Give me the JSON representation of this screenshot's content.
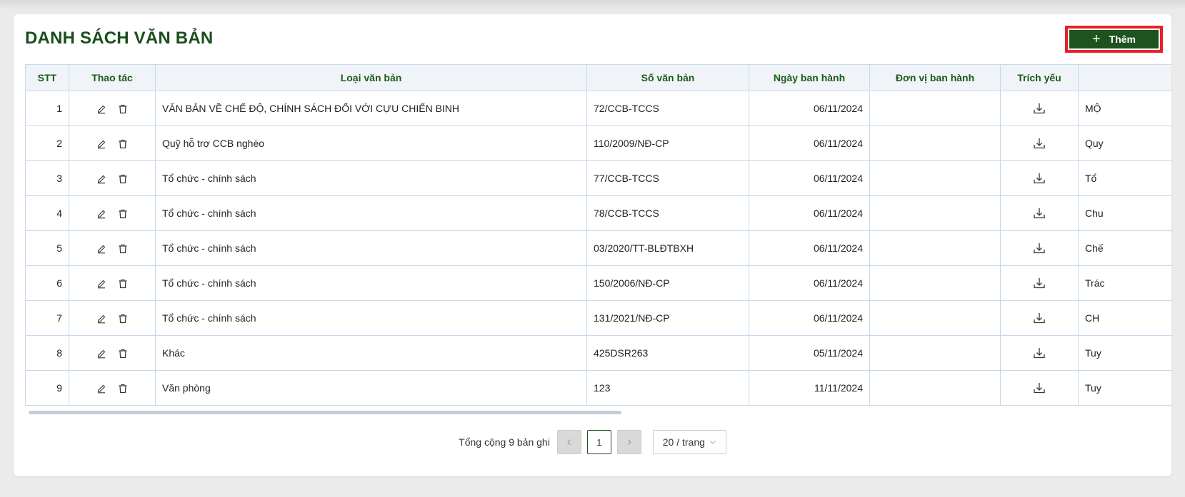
{
  "page": {
    "title": "DANH SÁCH VĂN BẢN",
    "add_label": "Thêm"
  },
  "table": {
    "headers": {
      "stt": "STT",
      "actions": "Thao tác",
      "type": "Loại văn bản",
      "number": "Số văn bản",
      "date": "Ngày ban hành",
      "unit": "Đơn vị ban hành",
      "abstract": "Trích yếu",
      "extra": ""
    },
    "rows": [
      {
        "stt": "1",
        "type": "VĂN BẢN VỀ CHẾ ĐỘ, CHÍNH SÁCH ĐỐI VỚI CỰU CHIẾN BINH",
        "number": "72/CCB-TCCS",
        "date": "06/11/2024",
        "unit": "",
        "extra": "MỘ"
      },
      {
        "stt": "2",
        "type": "Quỹ hỗ trợ CCB nghèo",
        "number": "110/2009/NĐ-CP",
        "date": "06/11/2024",
        "unit": "",
        "extra": "Quy"
      },
      {
        "stt": "3",
        "type": "Tổ chức - chính sách",
        "number": "77/CCB-TCCS",
        "date": "06/11/2024",
        "unit": "",
        "extra": "Tổ"
      },
      {
        "stt": "4",
        "type": "Tổ chức - chính sách",
        "number": "78/CCB-TCCS",
        "date": "06/11/2024",
        "unit": "",
        "extra": "Chu"
      },
      {
        "stt": "5",
        "type": "Tổ chức - chính sách",
        "number": "03/2020/TT-BLĐTBXH",
        "date": "06/11/2024",
        "unit": "",
        "extra": "Chế"
      },
      {
        "stt": "6",
        "type": "Tổ chức - chính sách",
        "number": "150/2006/NĐ-CP",
        "date": "06/11/2024",
        "unit": "",
        "extra": "Trác"
      },
      {
        "stt": "7",
        "type": "Tổ chức - chính sách",
        "number": "131/2021/NĐ-CP",
        "date": "06/11/2024",
        "unit": "",
        "extra": "CH"
      },
      {
        "stt": "8",
        "type": "Khác",
        "number": "425DSR263",
        "date": "05/11/2024",
        "unit": "",
        "extra": "Tuy"
      },
      {
        "stt": "9",
        "type": "Văn phòng",
        "number": "123",
        "date": "11/11/2024",
        "unit": "",
        "extra": "Tuy"
      }
    ]
  },
  "pagination": {
    "total_text": "Tổng cộng 9 bản ghi",
    "current_page": "1",
    "page_size": "20 / trang"
  },
  "colors": {
    "accent": "#1e521e",
    "title": "#1a4d1a",
    "highlight_border": "#e8202a"
  },
  "icons": [
    "plus-icon",
    "edit-icon",
    "trash-icon",
    "download-icon",
    "chevron-left-icon",
    "chevron-right-icon",
    "chevron-down-icon"
  ]
}
